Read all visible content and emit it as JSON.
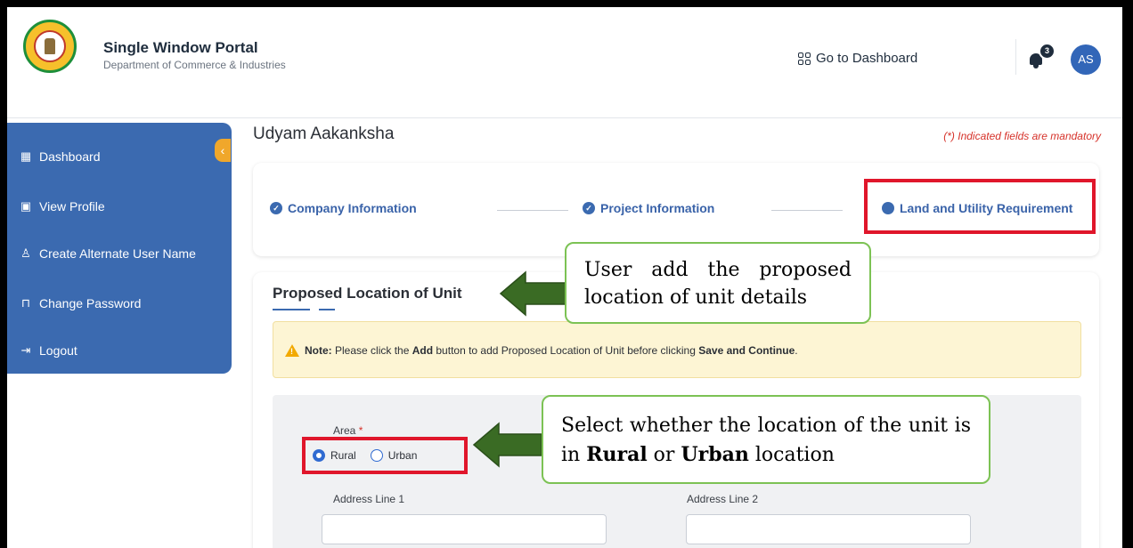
{
  "header": {
    "portal_title": "Single Window Portal",
    "portal_subtitle": "Department of Commerce & Industries",
    "go_to_dashboard": "Go to Dashboard",
    "notification_count": "3",
    "avatar_initials": "AS"
  },
  "sidebar": {
    "items": [
      {
        "label": "Dashboard",
        "icon": "grid-icon"
      },
      {
        "label": "View Profile",
        "icon": "profile-icon"
      },
      {
        "label": "Create Alternate User Name",
        "icon": "user-add-icon"
      },
      {
        "label": "Change Password",
        "icon": "lock-icon"
      },
      {
        "label": "Logout",
        "icon": "logout-icon"
      }
    ]
  },
  "page": {
    "title": "Udyam Aakanksha",
    "mandatory_note": "(*) Indicated fields are mandatory"
  },
  "steps": [
    {
      "label": "Company Information",
      "status": "completed"
    },
    {
      "label": "Project Information",
      "status": "completed"
    },
    {
      "label": "Land and Utility Requirement",
      "status": "current"
    }
  ],
  "section": {
    "title": "Proposed Location of Unit",
    "note_prefix": "Note:",
    "note_text_1": " Please click the ",
    "note_bold_1": "Add",
    "note_text_2": " button to add Proposed Location of Unit before clicking ",
    "note_bold_2": "Save and Continue",
    "note_text_3": "."
  },
  "form": {
    "area_label": "Area",
    "area_required": "*",
    "area_options": [
      "Rural",
      "Urban"
    ],
    "area_selected": "Rural",
    "address1_label": "Address Line 1",
    "address1_value": "",
    "address2_label": "Address Line 2",
    "address2_value": ""
  },
  "callouts": {
    "callout1_text": "User add the proposed location of unit details",
    "callout2_prefix": "Select whether the location of the unit is in ",
    "callout2_bold1": "Rural",
    "callout2_mid": " or ",
    "callout2_bold2": "Urban",
    "callout2_suffix": " location"
  },
  "colors": {
    "sidebar": "#3b6ab0",
    "accent_orange": "#f0a72b",
    "highlight_red": "#e0162b",
    "callout_border": "#7cc254",
    "arrow_green": "#3a6b24"
  }
}
